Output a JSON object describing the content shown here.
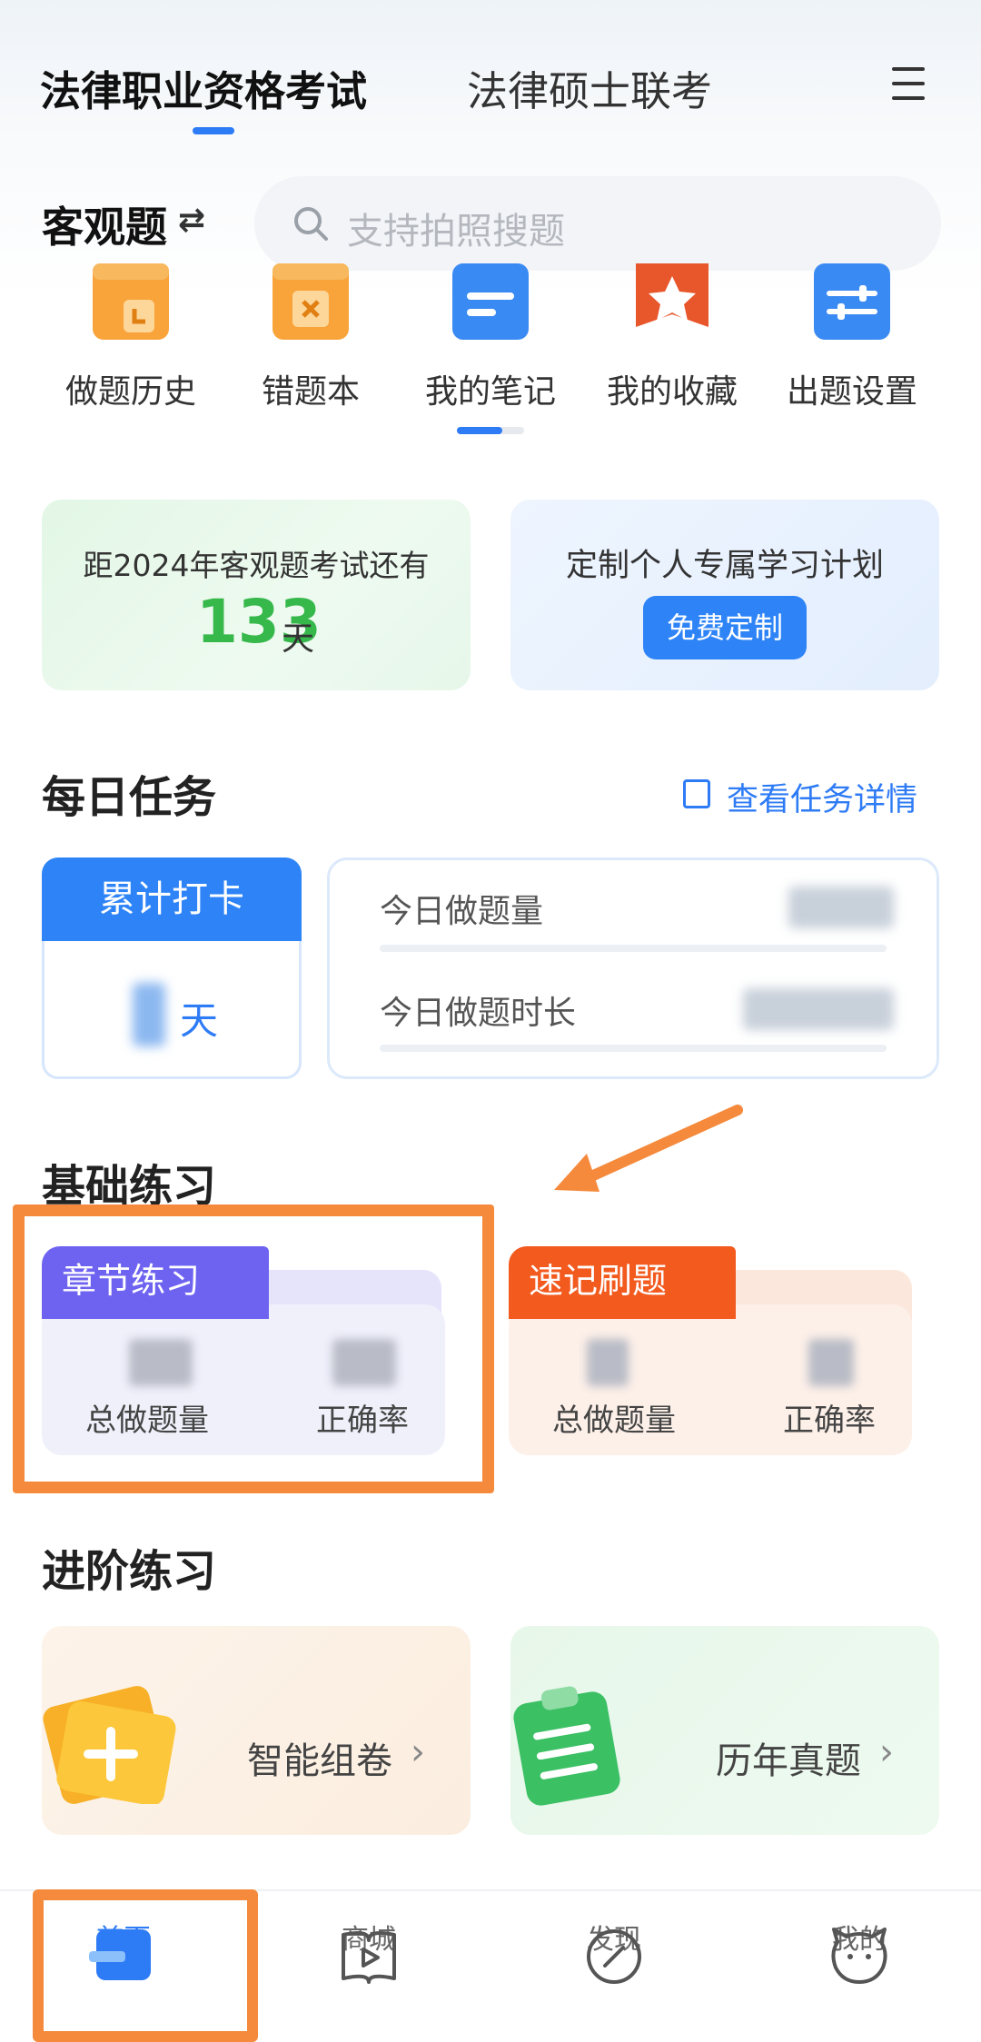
{
  "header": {
    "tabs": [
      {
        "label": "法律职业资格考试",
        "active": true
      },
      {
        "label": "法律硕士联考",
        "active": false
      }
    ],
    "menu_icon": "menu-icon"
  },
  "subject": {
    "label": "客观题",
    "switch_icon": "⇄"
  },
  "search": {
    "placeholder": "支持拍照搜题"
  },
  "quick_actions": [
    {
      "label": "做题历史",
      "icon": "history-icon"
    },
    {
      "label": "错题本",
      "icon": "wrong-book-icon"
    },
    {
      "label": "我的笔记",
      "icon": "notes-icon"
    },
    {
      "label": "我的收藏",
      "icon": "favorite-icon"
    },
    {
      "label": "出题设置",
      "icon": "settings-icon"
    }
  ],
  "countdown": {
    "text": "距2024年客观题考试还有",
    "days": "133",
    "unit": "天"
  },
  "plan": {
    "text": "定制个人专属学习计划",
    "button": "免费定制"
  },
  "daily_tasks": {
    "title": "每日任务",
    "link": "查看任务详情",
    "checkin_title": "累计打卡",
    "checkin_unit": "天",
    "today_count_label": "今日做题量",
    "today_time_label": "今日做题时长"
  },
  "basic": {
    "title": "基础练习",
    "cards": [
      {
        "tab": "章节练习",
        "stat1": "总做题量",
        "stat2": "正确率"
      },
      {
        "tab": "速记刷题",
        "stat1": "总做题量",
        "stat2": "正确率"
      }
    ]
  },
  "advanced": {
    "title": "进阶练习",
    "cards": [
      {
        "label": "智能组卷",
        "chevron": "›"
      },
      {
        "label": "历年真题",
        "chevron": "›"
      }
    ]
  },
  "bottom_nav": [
    {
      "label": "首页",
      "active": true
    },
    {
      "label": "商城",
      "active": false
    },
    {
      "label": "发现",
      "active": false
    },
    {
      "label": "我的",
      "active": false
    }
  ],
  "colors": {
    "accent": "#2e7bf6",
    "green": "#36b84b",
    "purple": "#6e63f0",
    "orange": "#f25a1e",
    "highlight": "#f58a3c"
  }
}
